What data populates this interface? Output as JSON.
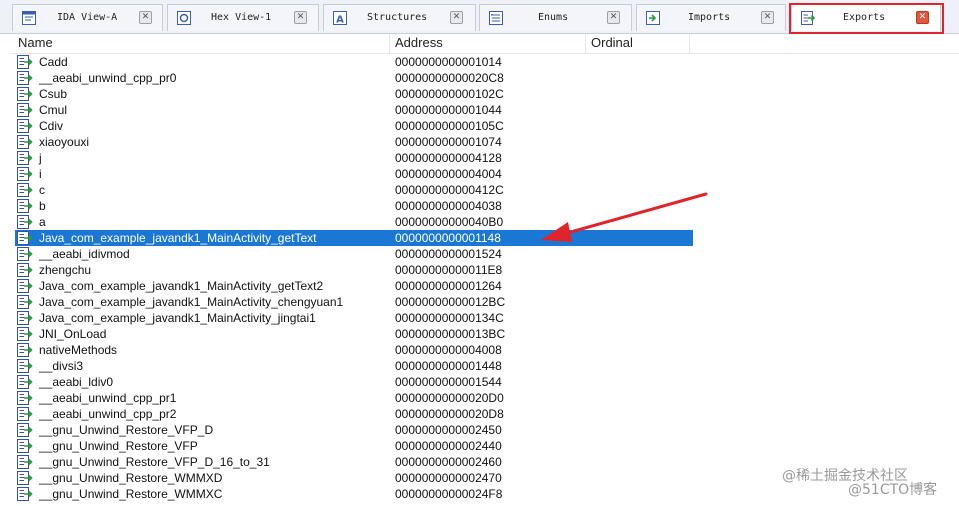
{
  "tabs": [
    {
      "label": "IDA View-A",
      "icon": "ida-view-icon",
      "active": false
    },
    {
      "label": "Hex View-1",
      "icon": "hex-view-icon",
      "active": false
    },
    {
      "label": "Structures",
      "icon": "structures-icon",
      "active": false
    },
    {
      "label": "Enums",
      "icon": "enums-icon",
      "active": false
    },
    {
      "label": "Imports",
      "icon": "imports-icon",
      "active": false
    },
    {
      "label": "Exports",
      "icon": "exports-icon",
      "active": true
    }
  ],
  "columns": {
    "name": "Name",
    "address": "Address",
    "ordinal": "Ordinal"
  },
  "rows": [
    {
      "name": "Cadd",
      "address": "0000000000001014"
    },
    {
      "name": "__aeabi_unwind_cpp_pr0",
      "address": "00000000000020C8"
    },
    {
      "name": "Csub",
      "address": "000000000000102C"
    },
    {
      "name": "Cmul",
      "address": "0000000000001044"
    },
    {
      "name": "Cdiv",
      "address": "000000000000105C"
    },
    {
      "name": "xiaoyouxi",
      "address": "0000000000001074"
    },
    {
      "name": "j",
      "address": "0000000000004128"
    },
    {
      "name": "i",
      "address": "0000000000004004"
    },
    {
      "name": "c",
      "address": "000000000000412C"
    },
    {
      "name": "b",
      "address": "0000000000004038"
    },
    {
      "name": "a",
      "address": "00000000000040B0"
    },
    {
      "name": "Java_com_example_javandk1_MainActivity_getText",
      "address": "0000000000001148",
      "selected": true
    },
    {
      "name": "__aeabi_idivmod",
      "address": "0000000000001524"
    },
    {
      "name": "zhengchu",
      "address": "00000000000011E8"
    },
    {
      "name": "Java_com_example_javandk1_MainActivity_getText2",
      "address": "0000000000001264"
    },
    {
      "name": "Java_com_example_javandk1_MainActivity_chengyuan1",
      "address": "00000000000012BC"
    },
    {
      "name": "Java_com_example_javandk1_MainActivity_jingtai1",
      "address": "000000000000134C"
    },
    {
      "name": "JNI_OnLoad",
      "address": "00000000000013BC"
    },
    {
      "name": "nativeMethods",
      "address": "0000000000004008"
    },
    {
      "name": "__divsi3",
      "address": "0000000000001448"
    },
    {
      "name": "__aeabi_ldiv0",
      "address": "0000000000001544"
    },
    {
      "name": "__aeabi_unwind_cpp_pr1",
      "address": "00000000000020D0"
    },
    {
      "name": "__aeabi_unwind_cpp_pr2",
      "address": "00000000000020D8"
    },
    {
      "name": "__gnu_Unwind_Restore_VFP_D",
      "address": "0000000000002450"
    },
    {
      "name": "__gnu_Unwind_Restore_VFP",
      "address": "0000000000002440"
    },
    {
      "name": "__gnu_Unwind_Restore_VFP_D_16_to_31",
      "address": "0000000000002460"
    },
    {
      "name": "__gnu_Unwind_Restore_WMMXD",
      "address": "0000000000002470"
    },
    {
      "name": "__gnu_Unwind_Restore_WMMXC",
      "address": "00000000000024F8"
    }
  ],
  "watermark": {
    "line1": "@稀土掘金技术社区",
    "line2": "@51CTO博客"
  },
  "colors": {
    "selection": "#1a78d4",
    "highlight_box": "#e0242b",
    "arrow": "#e0242b"
  }
}
